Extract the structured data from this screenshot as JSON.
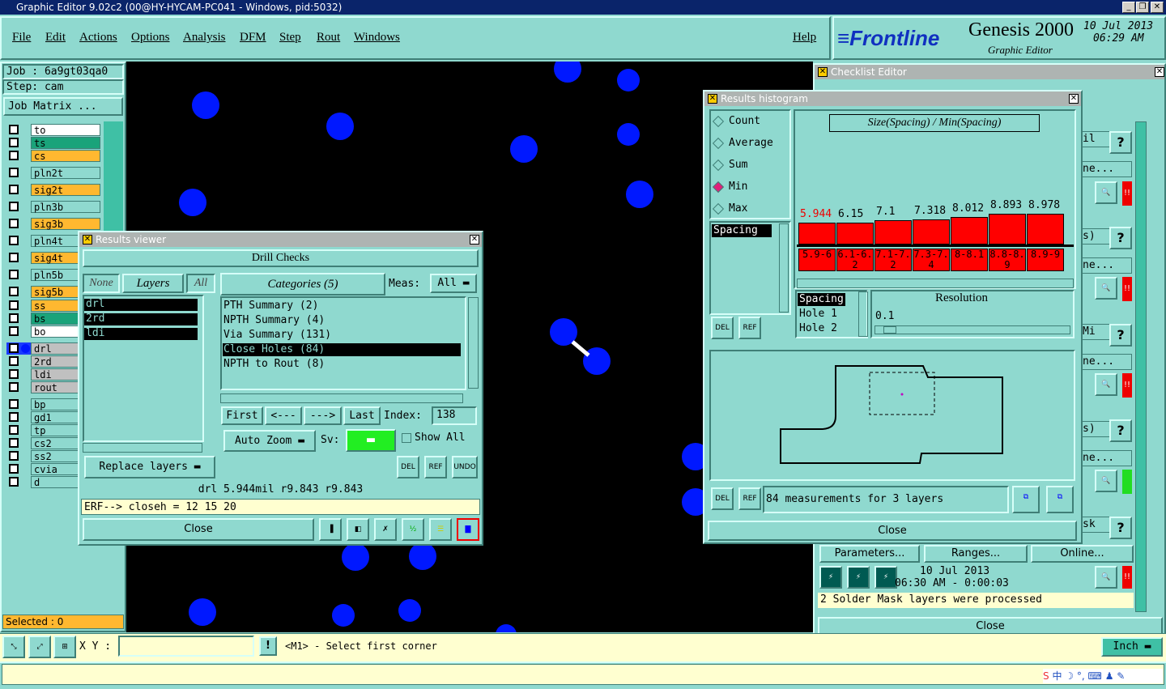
{
  "window": {
    "title": "Graphic Editor 9.02c2 (00@HY-HYCAM-PC041 - Windows, pid:5032)"
  },
  "menu": {
    "items": [
      "File",
      "Edit",
      "Actions",
      "Options",
      "Analysis",
      "DFM",
      "Step",
      "Rout",
      "Windows"
    ],
    "help": "Help"
  },
  "brand": {
    "logo": "Frontline",
    "product": "Genesis 2000",
    "subtitle": "Graphic Editor",
    "date": "10 Jul 2013",
    "time": "06:29 AM"
  },
  "job": {
    "job_label": "Job : 6a9gt03qa0",
    "step_label": "Step: cam",
    "matrix_button": "Job Matrix ..."
  },
  "layers": [
    {
      "name": "to",
      "color": "#ffffff"
    },
    {
      "name": "ts",
      "color": "#1aa37a"
    },
    {
      "name": "cs",
      "color": "#ffb830"
    },
    {
      "name": "pln2t",
      "color": "#8fd9cf"
    },
    {
      "name": "sig2t",
      "color": "#ffb830"
    },
    {
      "name": "pln3b",
      "color": "#8fd9cf"
    },
    {
      "name": "sig3b",
      "color": "#ffb830"
    },
    {
      "name": "pln4t",
      "color": "#8fd9cf"
    },
    {
      "name": "sig4t",
      "color": "#ffb830"
    },
    {
      "name": "pln5b",
      "color": "#8fd9cf"
    },
    {
      "name": "sig5b",
      "color": "#ffb830"
    },
    {
      "name": "ss",
      "color": "#ffb830"
    },
    {
      "name": "bs",
      "color": "#1aa37a"
    },
    {
      "name": "bo",
      "color": "#ffffff"
    },
    {
      "name": "drl",
      "color": "#c0c0c0"
    },
    {
      "name": "2rd",
      "color": "#c0c0c0"
    },
    {
      "name": "ldi",
      "color": "#c0c0c0"
    },
    {
      "name": "rout",
      "color": "#c0c0c0"
    },
    {
      "name": "bp",
      "color": "#8fd9cf"
    },
    {
      "name": "gd1",
      "color": "#8fd9cf"
    },
    {
      "name": "tp",
      "color": "#8fd9cf"
    },
    {
      "name": "cs2",
      "color": "#8fd9cf"
    },
    {
      "name": "ss2",
      "color": "#8fd9cf"
    },
    {
      "name": "cvia",
      "color": "#8fd9cf"
    },
    {
      "name": "d",
      "color": "#8fd9cf"
    }
  ],
  "selected_label": "Selected : 0",
  "results_viewer": {
    "title": "Results viewer",
    "header": "Drill Checks",
    "none_btn": "None",
    "layers_btn": "Layers",
    "all_btn": "All",
    "layer_list": [
      "drl",
      "2rd",
      "ldi"
    ],
    "categories_btn": "Categories (5)",
    "meas_label": "Meas:",
    "meas_value": "All",
    "categories": [
      "PTH Summary (2)",
      "NPTH Summary (4)",
      "Via Summary (131)",
      "Close Holes (84)",
      "NPTH to Rout (8)"
    ],
    "selected_category": 3,
    "first": "First",
    "prev": "<---",
    "next": "--->",
    "last": "Last",
    "index_label": "Index:",
    "index_value": "138",
    "auto_zoom": "Auto Zoom",
    "sv_label": "Sv:",
    "show_all": "Show All",
    "replace_layers": "Replace layers",
    "del": "DEL",
    "ref": "REF",
    "undo": "UNDO",
    "status": "drl 5.944mil   r9.843   r9.843",
    "erf": "ERF--> closeh = 12 15 20",
    "close": "Close"
  },
  "histogram": {
    "title": "Results histogram",
    "options": [
      "Count",
      "Average",
      "Sum",
      "Min",
      "Max"
    ],
    "selected_option": "Min",
    "measure_list": [
      "Spacing"
    ],
    "chart_title": "Size(Spacing) / Min(Spacing)",
    "bar_values": [
      "5.944",
      "6.15",
      "7.1",
      "7.318",
      "8.012",
      "8.893",
      "8.978"
    ],
    "bar_ranges": [
      "5.9-6",
      "6.1-6.2",
      "7.1-7.2",
      "7.3-7.4",
      "8-8.1",
      "8.8-8.9",
      "8.9-9"
    ],
    "bar_heights": [
      0.62,
      0.63,
      0.71,
      0.73,
      0.8,
      0.88,
      0.89
    ],
    "axes_list": [
      "Spacing",
      "Hole 1",
      "Hole 2"
    ],
    "resolution_label": "Resolution",
    "resolution_value": "0.1",
    "measurements_text": "84 measurements for 3 layers",
    "close": "Close"
  },
  "checklist": {
    "title": "Checklist Editor",
    "right_texts": [
      "il",
      "ne...",
      "s)",
      "ne...",
      "Mi",
      "ne...",
      "s)",
      "ne...",
      "sk"
    ],
    "parameters": "Parameters...",
    "ranges": "Ranges...",
    "online": "Online...",
    "date": "10 Jul 2013",
    "time": "06:30 AM - 0:00:03",
    "status": "2 Solder Mask layers were processed",
    "close": "Close"
  },
  "bottom": {
    "xy_label": "X Y :",
    "xy_value": "",
    "prompt": "<M1> - Select first corner",
    "unit": "Inch"
  },
  "colors": {
    "bg": "#8fd9cf",
    "canvas": "#000000",
    "drill": "#0018ff",
    "bar": "#ff0000",
    "highlight": "#ffb830"
  }
}
